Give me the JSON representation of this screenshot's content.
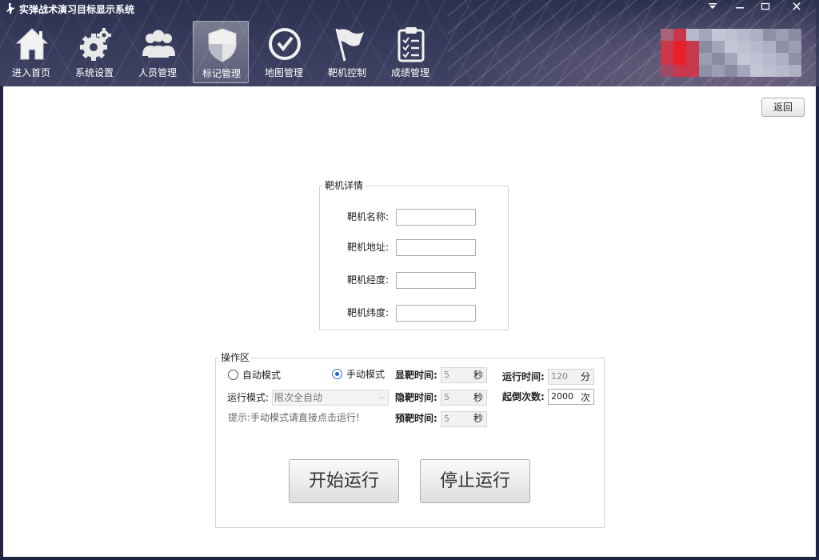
{
  "window": {
    "title": "实弹战术演习目标显示系统",
    "app_icon": "soldier-icon",
    "controls": {
      "menu": "⏷",
      "minimize": "—",
      "maximize": "☐",
      "close": "✕"
    }
  },
  "nav": {
    "items": [
      {
        "label": "进入首页",
        "icon": "home-icon"
      },
      {
        "label": "系统设置",
        "icon": "gear-icon"
      },
      {
        "label": "人员管理",
        "icon": "people-icon"
      },
      {
        "label": "标记管理",
        "icon": "shield-icon",
        "active": true
      },
      {
        "label": "地图管理",
        "icon": "check-circle-icon"
      },
      {
        "label": "靶机控制",
        "icon": "flag-icon"
      },
      {
        "label": "成绩管理",
        "icon": "clipboard-icon"
      }
    ]
  },
  "colors": {
    "header_bg": "#363a5a",
    "accent": "#1565d8",
    "mosaic_red": "#e8202a"
  },
  "content": {
    "back_label": "返回",
    "detail": {
      "title": "靶机详情",
      "fields": [
        {
          "label": "靶机名称:",
          "value": ""
        },
        {
          "label": "靶机地址:",
          "value": ""
        },
        {
          "label": "靶机经度:",
          "value": ""
        },
        {
          "label": "靶机纬度:",
          "value": ""
        }
      ]
    },
    "ops": {
      "title": "操作区",
      "radio_auto": "自动模式",
      "radio_manual": "手动模式",
      "mode_label": "运行模式:",
      "mode_value": "限次全自动",
      "hint": "提示:手动模式请直接点击运行!",
      "show_time": {
        "label": "显靶时间:",
        "value": "5",
        "unit": "秒"
      },
      "hide_time": {
        "label": "隐靶时间:",
        "value": "5",
        "unit": "秒"
      },
      "pre_time": {
        "label": "预靶时间:",
        "value": "5",
        "unit": "秒"
      },
      "run_time": {
        "label": "运行时间:",
        "value": "120",
        "unit": "分"
      },
      "count": {
        "label": "起倒次数:",
        "value": "2000",
        "unit": "次"
      },
      "start_label": "开始运行",
      "stop_label": "停止运行"
    }
  }
}
